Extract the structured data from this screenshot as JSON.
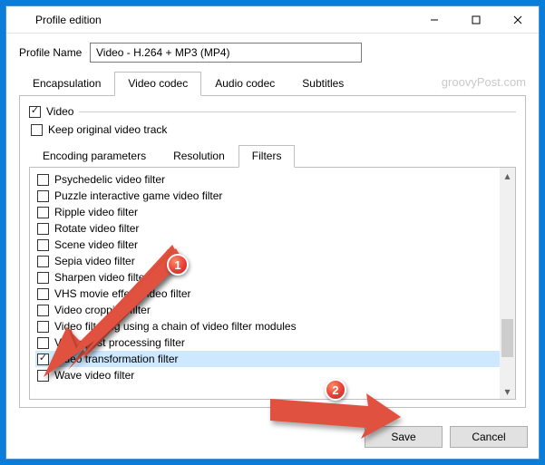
{
  "window": {
    "title": "Profile edition"
  },
  "profile": {
    "label": "Profile Name",
    "value": "Video - H.264 + MP3 (MP4)"
  },
  "watermark": "groovyPost.com",
  "main_tabs": {
    "encapsulation": "Encapsulation",
    "video_codec": "Video codec",
    "audio_codec": "Audio codec",
    "subtitles": "Subtitles"
  },
  "video_section": {
    "video_label": "Video",
    "keep_original": "Keep original video track"
  },
  "sub_tabs": {
    "encoding": "Encoding parameters",
    "resolution": "Resolution",
    "filters": "Filters"
  },
  "filters": [
    "Psychedelic video filter",
    "Puzzle interactive game video filter",
    "Ripple video filter",
    "Rotate video filter",
    "Scene video filter",
    "Sepia video filter",
    "Sharpen video filter",
    "VHS movie effect video filter",
    "Video cropping filter",
    "Video filtering using a chain of video filter modules",
    "Video post processing filter",
    "Video transformation filter",
    "Wave video filter"
  ],
  "footer": {
    "save": "Save",
    "cancel": "Cancel"
  },
  "annotations": {
    "badge1": "1",
    "badge2": "2"
  }
}
